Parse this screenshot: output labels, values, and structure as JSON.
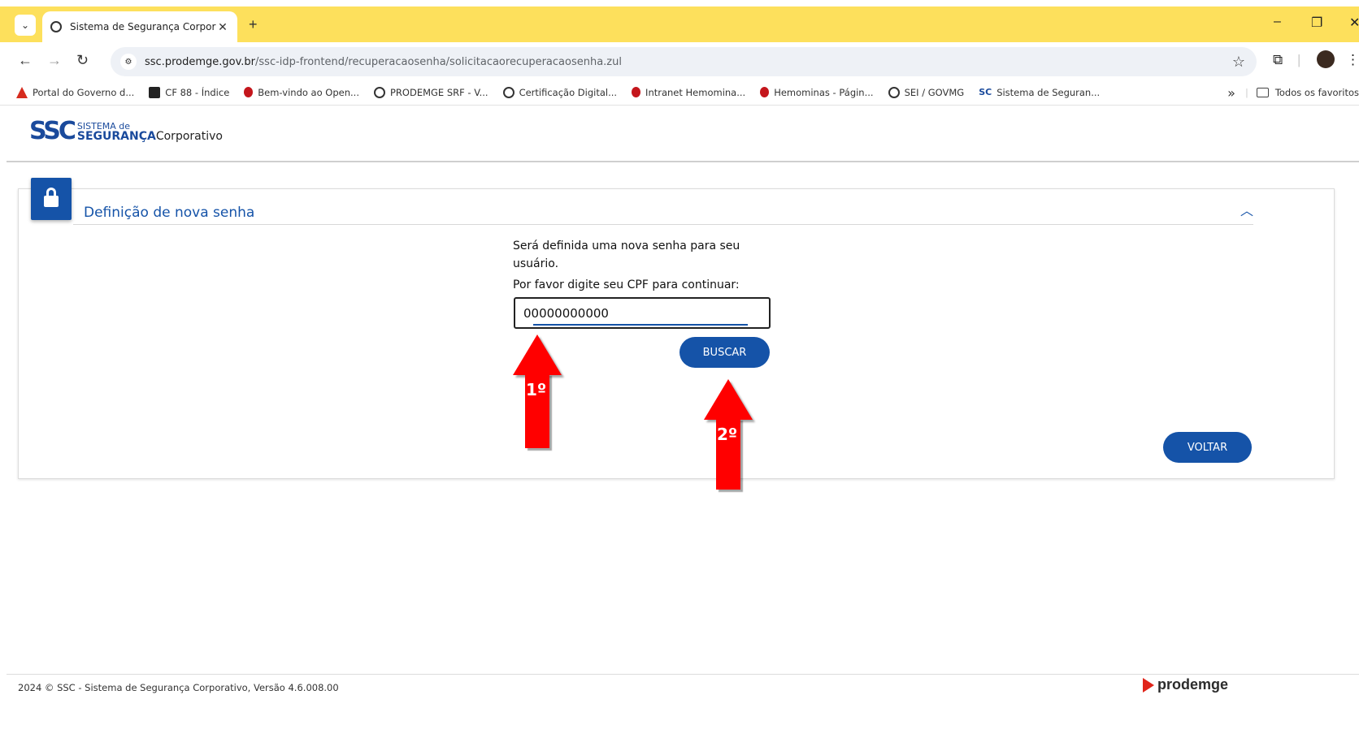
{
  "browser": {
    "tab_title": "Sistema de Segurança Corporat",
    "url_host": "ssc.prodemge.gov.br",
    "url_path": "/ssc-idp-frontend/recuperacaosenha/solicitacaorecuperacaosenha.zul",
    "bookmarks": [
      {
        "label": "Portal do Governo d...",
        "icon": "triangle-icon"
      },
      {
        "label": "CF 88 - Índice",
        "icon": "book-icon"
      },
      {
        "label": "Bem-vindo ao Open...",
        "icon": "drop-icon"
      },
      {
        "label": "PRODEMGE SRF - V...",
        "icon": "globe-icon"
      },
      {
        "label": "Certificação Digital...",
        "icon": "globe-icon"
      },
      {
        "label": "Intranet Hemomina...",
        "icon": "drop-icon"
      },
      {
        "label": "Hemominas - Págin...",
        "icon": "drop-icon"
      },
      {
        "label": "SEI / GOVMG",
        "icon": "globe-icon"
      },
      {
        "label": "Sistema de Seguran...",
        "icon": "ssc-icon"
      }
    ],
    "bookmarks_more": "»",
    "all_bookmarks": "Todos os favoritos"
  },
  "header": {
    "logo_mark": "SSC",
    "logo_small": "SISTEMA de",
    "logo_bold": "SEGURANÇA",
    "logo_rest": "Corporativo"
  },
  "panel": {
    "title": "Definição de nova senha",
    "message": "Será definida uma nova senha para seu usuário.",
    "prompt": "Por favor digite seu CPF para continuar:",
    "cpf_value": "00000000000",
    "buscar_label": "BUSCAR",
    "voltar_label": "VOLTAR"
  },
  "annotations": {
    "step1": "1º",
    "step2": "2º",
    "arrow_color": "#ff0000"
  },
  "footer": {
    "text": "2024 © SSC - Sistema de Segurança Corporativo, Versão 4.6.008.00",
    "brand": "prodemge"
  },
  "colors": {
    "accent": "#1553a8",
    "tab_strip": "#fde05c"
  }
}
